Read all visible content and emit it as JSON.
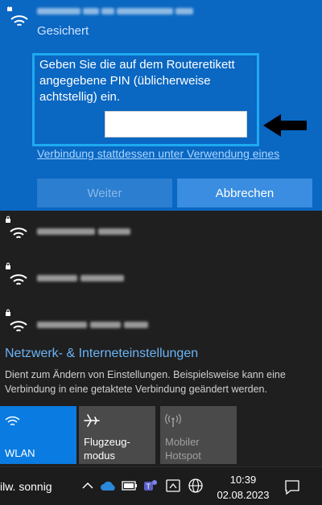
{
  "selected_network": {
    "status": "Gesichert",
    "pin_prompt": "Geben Sie die auf dem Routeretikett angegebene PIN (üblicherweise achtstellig) ein.",
    "pin_value": "",
    "alt_link": "Verbindung stattdessen unter Verwendung eines",
    "next_label": "Weiter",
    "cancel_label": "Abbrechen"
  },
  "network_settings": {
    "title": "Netzwerk- & Interneteinstellungen",
    "description": "Dient zum Ändern von Einstellungen. Beispielsweise kann eine Verbindung in eine getaktete Verbindung geändert werden."
  },
  "quick_actions": [
    {
      "label": "WLAN",
      "icon": "wifi-icon",
      "active": true
    },
    {
      "label": "Flugzeug-\nmodus",
      "icon": "airplane-icon",
      "active": false
    },
    {
      "label": "Mobiler\nHotspot",
      "icon": "hotspot-icon",
      "active": false,
      "disabled": true
    }
  ],
  "taskbar": {
    "weather": "ilw. sonnig",
    "time": "10:39",
    "date": "02.08.2023"
  },
  "colors": {
    "panel_blue": "#0a67c2",
    "highlight_border": "#1eaaf1",
    "link": "#a9d6ff",
    "settings_link": "#6cb4f5",
    "active_tile": "#0a7be0"
  }
}
